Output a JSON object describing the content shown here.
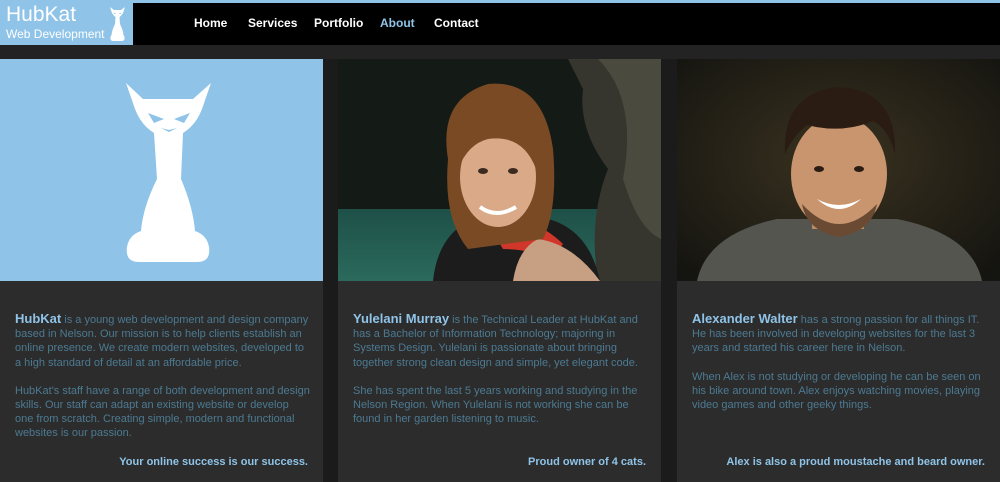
{
  "logo": {
    "name": "HubKat",
    "subtitle": "Web Development"
  },
  "nav": {
    "items": [
      {
        "label": "Home",
        "active": false
      },
      {
        "label": "Services",
        "active": false
      },
      {
        "label": "Portfolio",
        "active": false
      },
      {
        "label": "About",
        "active": true
      },
      {
        "label": "Contact",
        "active": false
      }
    ]
  },
  "colors": {
    "accent": "#8fc4e8",
    "body_text": "#4c7a92",
    "card_bg": "#2c2c2c",
    "nav_bg": "#000000"
  },
  "cards": [
    {
      "name": "HubKat",
      "intro": " is a young web development and design company based in Nelson. Our mission is to help clients establish an online presence. We create modern websites, developed to a high standard of detail at an affordable price.",
      "para2": "HubKat's staff have a range of both development and design skills. Our staff can adapt an existing website or develop one from scratch. Creating simple, modern and functional websites is our passion.",
      "tagline": "Your online success is our success.",
      "image": "white-cat-logo"
    },
    {
      "name": "Yulelani Murray",
      "intro": " is the Technical Leader at HubKat and has a Bachelor of Information Technology; majoring in Systems Design. Yulelani is passionate about bringing together strong clean design and simple, yet elegant code.",
      "para2": "She has spent the last 5 years working and studying in the Nelson Region. When Yulelani is not working she can be found in her garden listening to music.",
      "tagline": "Proud owner of 4 cats.",
      "image": "photo-of-woman-in-life-jacket-by-water"
    },
    {
      "name": "Alexander Walter",
      "intro": " has a strong passion for all things IT. He has been involved in developing websites for the last 3 years and started his career here in Nelson.",
      "para2": "When Alex is not studying or developing he can be seen on his bike around town. Alex enjoys watching movies, playing video games and other geeky things.",
      "tagline": "Alex is also a proud moustache and beard owner.",
      "image": "photo-of-smiling-bearded-man"
    }
  ]
}
